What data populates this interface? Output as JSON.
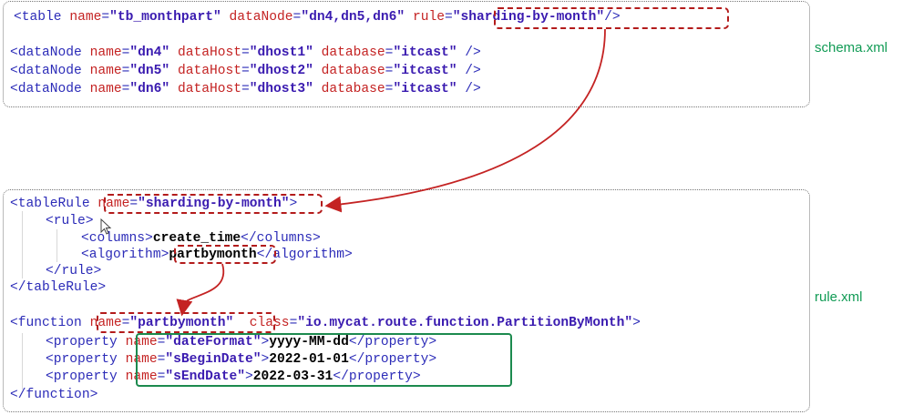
{
  "schema": {
    "filename": "schema.xml",
    "table_line": {
      "open": "<table",
      "name_attr": "name",
      "name_val": "\"tb_monthpart\"",
      "datanode_attr": "dataNode",
      "datanode_val": "\"dn4,dn5,dn6\"",
      "rule_attr": "rule",
      "rule_val": "\"sharding-by-month\"",
      "close": "/>"
    },
    "datanodes": [
      {
        "name": "\"dn4\"",
        "host": "\"dhost1\"",
        "db": "\"itcast\""
      },
      {
        "name": "\"dn5\"",
        "host": "\"dhost2\"",
        "db": "\"itcast\""
      },
      {
        "name": "\"dn6\"",
        "host": "\"dhost3\"",
        "db": "\"itcast\""
      }
    ],
    "dn_tag": "<dataNode",
    "dn_name_attr": "name",
    "dn_host_attr": "dataHost",
    "dn_db_attr": "database",
    "dn_close": "/>"
  },
  "rule": {
    "filename": "rule.xml",
    "tablerule_open": "<tableRule",
    "tablerule_name_attr": "name",
    "tablerule_name_val": "\"sharding-by-month\"",
    "tablerule_gt": ">",
    "rule_open": "<rule>",
    "columns_open": "<columns>",
    "columns_val": "create_time",
    "columns_close": "</columns>",
    "algorithm_open": "<algorithm>",
    "algorithm_val": "partbymonth",
    "algorithm_close": "</algorithm>",
    "rule_close": "</rule>",
    "tablerule_close": "</tableRule>",
    "function_open": "<function",
    "function_name_attr": "name",
    "function_name_val": "\"partbymonth\"",
    "function_class_attr": "class",
    "function_class_val": "\"io.mycat.route.function.PartitionByMonth\"",
    "function_gt": ">",
    "property_open": "<property",
    "property_name_attr": "name",
    "property_close": "</property>",
    "properties": [
      {
        "name": "\"dateFormat\"",
        "value": "yyyy-MM-dd"
      },
      {
        "name": "\"sBeginDate\"",
        "value": "2022-01-01"
      },
      {
        "name": "\"sEndDate\"",
        "value": "2022-03-31"
      }
    ],
    "function_close": "</function>"
  },
  "colors": {
    "tag": "#2c2cb8",
    "attr": "#c42323",
    "value": "#3a1bb0",
    "highlight": "#b31b1b",
    "property_box": "#1c8a4e",
    "filename": "#119b55"
  },
  "icons": [
    "mouse-cursor-icon",
    "arrow-connector"
  ]
}
